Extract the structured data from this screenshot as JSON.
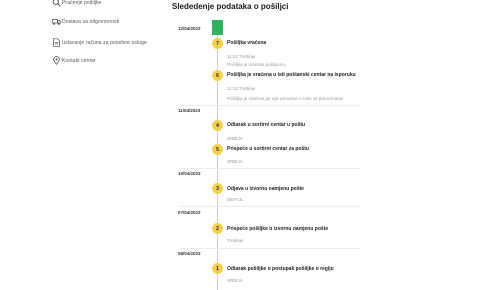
{
  "sidebar": {
    "items": [
      {
        "label": "Praćenje pošiljke",
        "icon": "search-icon"
      },
      {
        "label": "Dostava sa odgovornosti",
        "icon": "truck-icon"
      },
      {
        "label": "Izdavanje računa za posebne usluge",
        "icon": "document-icon"
      },
      {
        "label": "Kontakt centar",
        "icon": "location-pin-icon"
      }
    ]
  },
  "page": {
    "title": "Slededenje   podataka o pošiljci"
  },
  "timeline": {
    "groups": [
      {
        "date": "12/04/2023",
        "events": [
          {
            "num": "7",
            "title": "Pošiljka vraćena",
            "lines": [
              "11:22 Trebinje",
              "Pošiljka je vraćena pošiljaocu"
            ]
          },
          {
            "num": "6",
            "title": "Pošiljka je vraćena u isti poštanski centar na isporuku",
            "lines": [
              "11:22 Trebinje",
              "Pošiljka je vraćena jer nije preuzeta u roku za preuzimanje"
            ]
          }
        ]
      },
      {
        "date": "11/04/2023",
        "events": [
          {
            "num": "4",
            "title": "Odlazak u sortirni centar u poštu",
            "lines": [
              "SRBIJA"
            ]
          },
          {
            "num": "5",
            "title": "Prispeće u sortirni centar za poštu",
            "lines": [
              "SRBIJA"
            ]
          }
        ]
      },
      {
        "date": "10/04/2023",
        "events": [
          {
            "num": "3",
            "title": "Odjava u izvornu namjenu pošte",
            "lines": [
              "DETAJL"
            ]
          }
        ]
      },
      {
        "date": "07/04/2023",
        "events": [
          {
            "num": "2",
            "title": "Prispeće pošiljke u izvornu namjenu pošte",
            "lines": [
              "Trebinje"
            ]
          }
        ]
      },
      {
        "date": "06/04/2023",
        "events": [
          {
            "num": "1",
            "title": "Odlazak pošiljke u postupak pošiljke u regiju",
            "lines": [
              "SRBIJA"
            ]
          }
        ]
      }
    ]
  },
  "colors": {
    "accent_green": "#2db35d",
    "step_yellow": "#f5d04e"
  }
}
